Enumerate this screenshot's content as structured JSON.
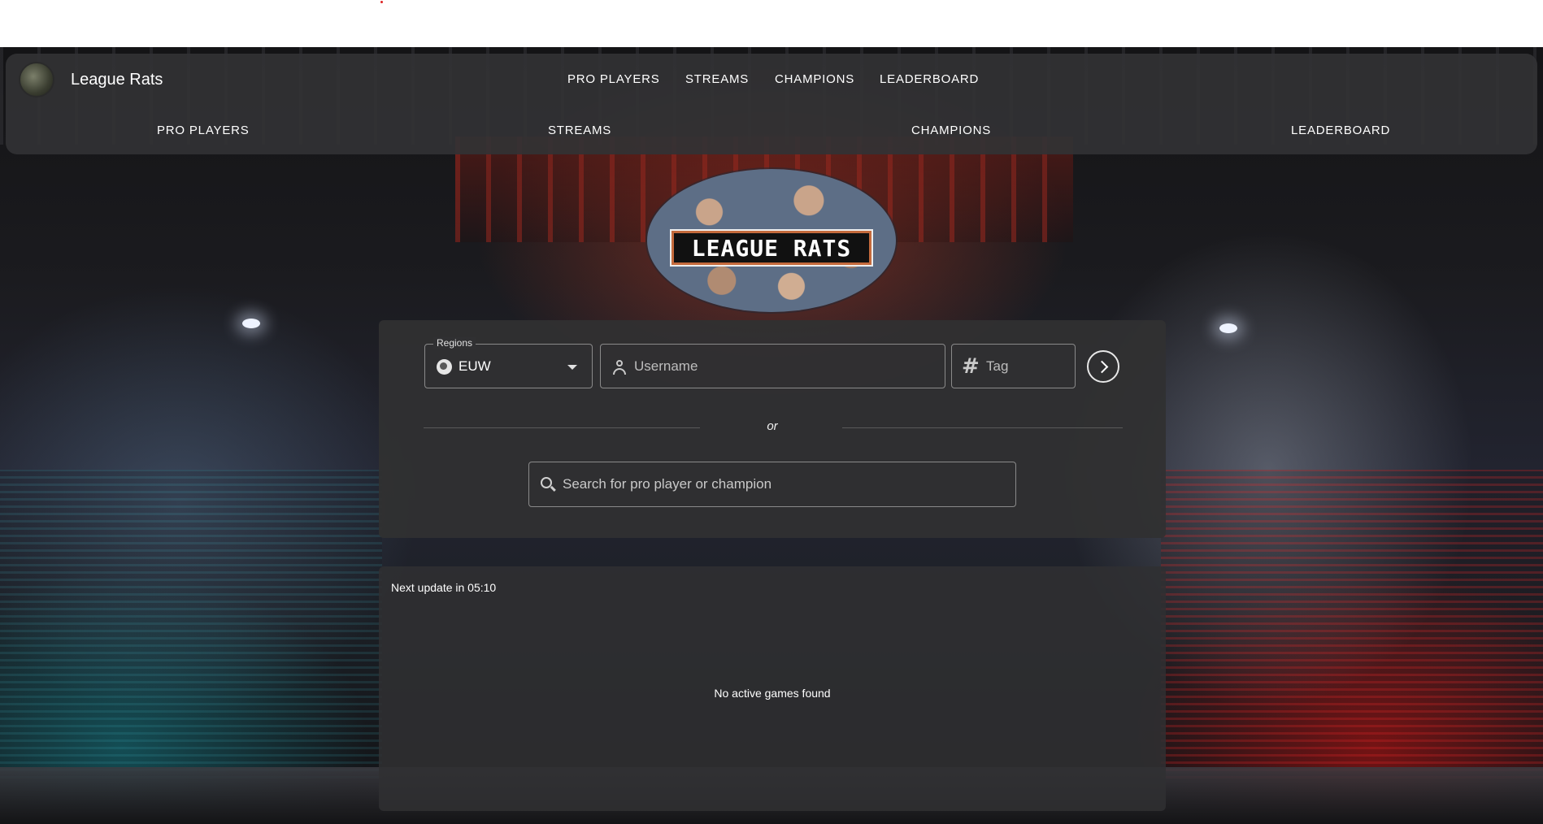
{
  "app": {
    "brand": "League Rats"
  },
  "nav": {
    "top": [
      "PRO PLAYERS",
      "STREAMS",
      "CHAMPIONS",
      "LEADERBOARD"
    ],
    "bottom": [
      "PRO PLAYERS",
      "STREAMS",
      "CHAMPIONS",
      "LEADERBOARD"
    ]
  },
  "hero": {
    "logo_text": "LEAGUE RATS"
  },
  "search": {
    "region_legend": "Regions",
    "region_value": "EUW",
    "username_placeholder": "Username",
    "tag_placeholder": "Tag",
    "or_text": "or",
    "global_placeholder": "Search for pro player or champion"
  },
  "games": {
    "next_update": "Next update in 05:10",
    "empty_message": "No active games found"
  },
  "icons": [
    "globe-icon",
    "chevron-down-icon",
    "user-icon",
    "hash-icon",
    "chevron-right-icon",
    "search-icon"
  ]
}
